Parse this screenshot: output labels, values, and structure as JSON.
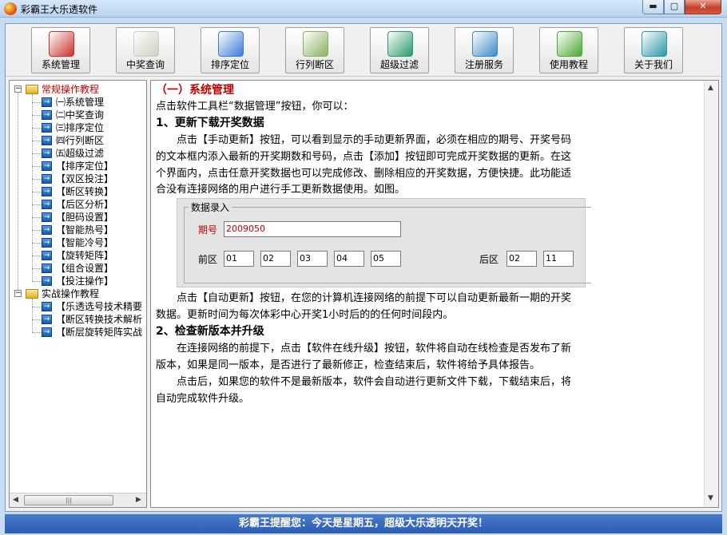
{
  "window": {
    "title": "彩霸王大乐透软件",
    "min_label": "▬",
    "max_label": "▢",
    "close_label": "✕"
  },
  "toolbar": [
    {
      "label": "系统管理",
      "icon": "toolbox-icon",
      "color": "#c83228"
    },
    {
      "label": "中奖查询",
      "icon": "ticket-icon",
      "color": "#cfcfbf"
    },
    {
      "label": "排序定位",
      "icon": "compass-icon",
      "color": "#3a7ad8"
    },
    {
      "label": "行列断区",
      "icon": "notepad-icon",
      "color": "#8ab060"
    },
    {
      "label": "超级过滤",
      "icon": "cube-icon",
      "color": "#2a9a6a"
    },
    {
      "label": "注册服务",
      "icon": "keys-icon",
      "color": "#3a8ac8"
    },
    {
      "label": "使用教程",
      "icon": "user-icon",
      "color": "#4aa830"
    },
    {
      "label": "关于我们",
      "icon": "phone-icon",
      "color": "#2a98a8"
    }
  ],
  "tree": {
    "group1": "常规操作教程",
    "group1_items": [
      "㈠系统管理",
      "㈡中奖查询",
      "㈢排序定位",
      "㈣行列断区",
      "㈤超级过滤",
      "【排序定位】",
      "【双区投注】",
      "【断区转换】",
      "【后区分析】",
      "【胆码设置】",
      "【智能热号】",
      "【智能冷号】",
      "【旋转矩阵】",
      "【组合设置】",
      "【投注操作】"
    ],
    "group2": "实战操作教程",
    "group2_items": [
      "【乐透选号技术精要",
      "【断区转换技术解析",
      "【断层旋转矩阵实战"
    ]
  },
  "content": {
    "section_title": "（一）系统管理",
    "intro": "点击软件工具栏“数据管理”按钮，你可以：",
    "h1": "1、更新下载开奖数据",
    "p1": [
      "　　点击【手动更新】按钮，可以看到显示的手动更新界面，必须在相应的期号、开奖号码",
      "的文本框内添入最新的开奖期数和号码，点击【添加】按钮即可完成开奖数据的更新。在这",
      "个界面内，点击任意开奖数据也可以完成修改、删除相应的开奖数据，方便快捷。此功能适",
      "合没有连接网络的用户进行手工更新数据使用。如图。"
    ],
    "p2": [
      "　　点击【自动更新】按钮，在您的计算机连接网络的前提下可以自动更新最新一期的开奖",
      "数据。更新时间为每次体彩中心开奖1小时后的的任何时间段内。"
    ],
    "h2": "2、检查新版本并升级",
    "p3": [
      "　　在连接网络的前提下，点击【软件在线升级】按钮，软件将自动在线检查是否发布了新",
      "版本，如果是同一版本，是否进行了最新修正，检查结束后，软件将给予具体报告。"
    ],
    "p4": [
      "　　点击后，如果您的软件不是最新版本，软件会自动进行更新文件下载，下载结束后，将",
      "自动完成软件升级。"
    ]
  },
  "panel": {
    "title": "数据录入",
    "issue_label": "期号",
    "issue_value": "2009050",
    "front_label": "前区",
    "front_values": [
      "01",
      "02",
      "03",
      "04",
      "05"
    ],
    "back_label": "后区",
    "back_values": [
      "02",
      "11"
    ]
  },
  "status": "彩霸王提醒您：今天是星期五，超级大乐透明天开奖！"
}
